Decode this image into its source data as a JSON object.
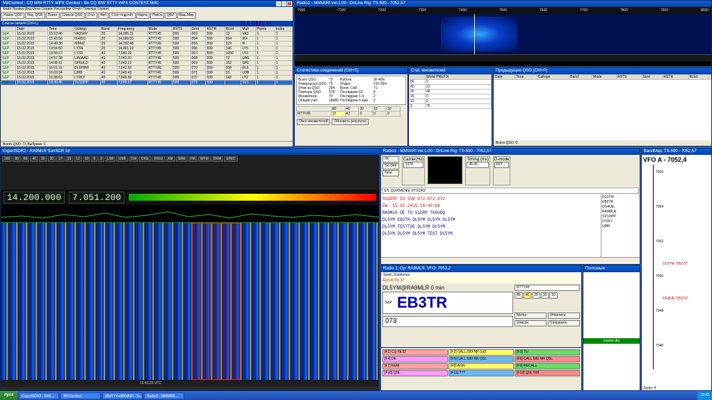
{
  "contest": {
    "title": "5MContest - CQ WW RTTY WPX Contest - file CQ WW RTTY WPX CONTEST.5MC",
    "menu": "Файл   Правка   Вид   Окна   Сервис   Настройки   Отчёт   Помощь   Сервис",
    "toolbar": [
      "Новое QSO",
      "Ред. QSO",
      "Поиск",
      "Список QSO",
      "Стат.",
      "Веб",
      "Стат. подсчёт",
      "Карта",
      "Поиск",
      "QRZ",
      "Ваш.Мир"
    ],
    "callsign": "RA9MLR",
    "list_title": "Список связей (Ctrl+L)",
    "headers": [
      "",
      "Date",
      "Time",
      "Callsign",
      "Band",
      "Frequency",
      "Mode",
      "RSTS",
      "Sent",
      "RSTR",
      "Rcvd",
      "Mult",
      "Points",
      "Index"
    ],
    "rows": [
      [
        "S&P",
        "15.02.2015",
        "15:10:46",
        "VA3SKY",
        "20",
        "14,085.11",
        "RTTY45",
        "599",
        "063",
        "599",
        "12",
        "VA3",
        "3",
        "1"
      ],
      [
        "S&P",
        "15.02.2015",
        "15:43:56",
        "IK4ISO",
        "20",
        "14,089.30",
        "RTTY45",
        "599",
        "064",
        "599",
        "654",
        "IK4",
        "1",
        "1"
      ],
      [
        "S&P",
        "15.02.2015",
        "14:49:38",
        "I6BMZ",
        "20",
        "14,092.48",
        "RTTY45",
        "599",
        "065",
        "599",
        "319",
        "I6",
        "1",
        "1"
      ],
      [
        "S&P",
        "15.02.2015",
        "14:54:50",
        "LY5N",
        "20",
        "14,091.19",
        "RTTY45",
        "599",
        "066",
        "599",
        "146",
        "LY5",
        "1",
        "1"
      ],
      [
        "S&P",
        "15.02.2015",
        "14:56:17",
        "LY3D",
        "40",
        "7,040.32",
        "RTTY45",
        "599",
        "067",
        "599",
        "1050",
        "LY3",
        "1",
        "1"
      ],
      [
        "S&P",
        "15.02.2015",
        "14:57:38",
        "UA6AAD",
        "40",
        "7,041.37",
        "RTTY45",
        "599",
        "068",
        "599",
        "72",
        "UA6",
        "1",
        "1"
      ],
      [
        "S&P",
        "15.02.2015",
        "14:58:11",
        "SP6ULD",
        "40",
        "7,042.22",
        "RTTY45",
        "599",
        "069",
        "599",
        "152",
        "SP6",
        "1",
        "1"
      ],
      [
        "S&P",
        "15.02.2015",
        "16:01:15",
        "DL6PBW",
        "40",
        "7,042.92",
        "RTTY45",
        "599",
        "070",
        "599",
        "508",
        "DL6",
        "1",
        "1"
      ],
      [
        "S&P",
        "15.02.2015",
        "16:03:34",
        "U9BI",
        "40",
        "7,049.43",
        "RTTY45",
        "599",
        "071",
        "599",
        "53",
        "U9B",
        "1",
        "1"
      ],
      [
        "S&P",
        "15.02.2015",
        "16:38:03",
        "LY2KY",
        "40",
        "7,049.50",
        "RTTY45",
        "599",
        "072",
        "599",
        "142",
        "LY2",
        "1",
        "1"
      ],
      [
        "S&P",
        "15.02.2015",
        "16:40:46",
        "SV1DPP",
        "40",
        "7,049.57",
        "RTTY45",
        "599",
        "073",
        "599",
        "",
        "SV1",
        "1",
        "1"
      ]
    ],
    "status": "Всего QSO: 73        Выбрано: 1"
  },
  "mmvari_top": {
    "title": "Radio1 - MMVARI ver.1.00 : OnLine Rig: TS-590 - 7052,57",
    "scale": [
      "7000",
      "7100",
      "7200",
      "7300",
      "7400",
      "7500",
      "7600",
      "7700",
      "7800",
      "7900",
      "8000"
    ]
  },
  "stats": {
    "title": "Статистика соединений (Ctrl+S)",
    "lines": [
      [
        "Всего QSO",
        "73",
        "Работа",
        "3h 40m"
      ],
      [
        "Уникальных QSO",
        "73",
        "Отдых",
        "21h 25m"
      ],
      [
        "Очки за QSO",
        "264",
        "Бонус Call",
        "71"
      ],
      [
        "Повторы QSO",
        "578",
        "Последние 10",
        "4"
      ],
      [
        "Множители",
        "70",
        "Последние 1 Ч",
        "2"
      ],
      [
        "Общий счёт",
        "18480",
        "Последние 5 мин",
        "2"
      ]
    ],
    "bands": [
      "160",
      "80",
      "40",
      "20",
      "15",
      "10"
    ],
    "mode": "RTTY45",
    "btns": [
      "Окно множителей",
      "Обновить результат"
    ]
  },
  "mults": {
    "title": "Стат. множителей",
    "headers": [
      "",
      "World PREFIX"
    ],
    "rows": [
      [
        "80",
        "0"
      ],
      [
        "40",
        "22"
      ],
      [
        "20",
        "48"
      ],
      [
        "15",
        "0"
      ],
      [
        "10",
        "0"
      ],
      [
        "Σ",
        "70"
      ]
    ]
  },
  "prev": {
    "title": "Предыдущие QSO (Ctrl+P)",
    "headers": [
      "Date",
      "Time",
      "Callsign",
      "Band",
      "Mode",
      "RSTS",
      "Sent",
      "RSTR",
      "Rcvd"
    ],
    "status": "Всего QSO: 0"
  },
  "sdr": {
    "title": "ExpertSDR2 - RA9MLR SunSDR 1d",
    "freq_a": "14.200.000",
    "freq_b": "7.051.200",
    "band_btns": [
      "160",
      "80",
      "60",
      "40",
      "30",
      "20",
      "17",
      "15",
      "12",
      "10",
      "6",
      "2"
    ],
    "mode_btns": [
      "LSB",
      "USB",
      "CW",
      "DIGL",
      "DIGU",
      "AM",
      "SAM",
      "FM",
      "WFM",
      "DRM",
      "SPEC"
    ],
    "status": "16:43:29 UTC"
  },
  "mmvari": {
    "title": "Radio1 - MMVARI ver.1.00 : OnLine Rig: TS-590 - 7052,57",
    "tx": "TX",
    "txoff": "TX OFF",
    "tone": "Tone",
    "carrier": "Carrier(Hz)",
    "rx": "1378",
    "timing": "Timing (ms)",
    "dmode": "D-mode",
    "fft": "FFT",
    "baud": "45.45",
    "macro": "S/C QUIPMENIE OTCQRZ",
    "text_lines": [
      "SV1DPP  EU 599 072-072-072",
      "EW. 15.02.2015 16:40:06",
      "RA9MLR  DE  TU  S1DPP  TX0UDQ",
      "DL5YM EB3TR DL5YM  DL5YM DL5YM",
      "DL5YM  TESTTOE DL5YM DL5YM",
      "DL5YM  DL5YM  DL5YM TEST DL5YM"
    ],
    "side_calls": [
      "DL5YM",
      "EB3TR",
      "DG4UE",
      "RA9MLR",
      "SV1DPP",
      "LY2KY",
      "U9BI"
    ]
  },
  "entry": {
    "title": "Radio 1; Op: RA9MLR: VFO: 7052,2",
    "country": "Spain, Catalunya",
    "info": "EU 14  ITU 37",
    "qso_line": "DL5YM@RA9MLR  0 min",
    "callsign": "EB3TR",
    "sp": "S&P",
    "number": "073",
    "mode": "RTTY45",
    "band": "40",
    "bands": [
      "80",
      "40",
      "20",
      "15",
      "10"
    ],
    "btns": [
      "Метка",
      "Отметить",
      "Список",
      "Сохранить"
    ]
  },
  "macros": [
    [
      "[F1] CQ TEST",
      "[F2] CALL 599 NR Call",
      "[F3] TU"
    ],
    [
      "[F4] DE",
      "[F5] CALL 599 NR QSL",
      "[F6] CALL 599 NR QSL"
    ],
    [
      "[F7] NUM",
      "[F8] AGN",
      "[F9] RECALL"
    ],
    [
      "[F10] QSL",
      "[F11] ???",
      "[F12] QSL 599"
    ]
  ],
  "colors": {
    "m1": "#ffa0a0",
    "m2": "#ffff66",
    "m3": "#66dd66",
    "m4": "#ff99ff",
    "m5": "#66bbff",
    "m6": "#ff8888"
  },
  "small": {
    "title": "Полезные",
    "master": "master.dta"
  },
  "bandmap": {
    "title": "BandMap: TS-590 - 7052,57",
    "vfo": "VFO A - 7052,4",
    "spots": [
      "DL5YM 7052,57",
      "DG4UE 7052,57"
    ],
    "scale": [
      "7056",
      "7054",
      "7052",
      "7050",
      "7048",
      "7046"
    ],
    "status": "Spots: 4"
  },
  "taskbar": {
    "start": "пуск",
    "tasks": [
      "ExpertSDR2 - RA9...",
      "5M Contest",
      "MMTTY+MMVARI - Te...",
      "Radio1 - MMVARI ..."
    ],
    "clock": "22:43"
  }
}
